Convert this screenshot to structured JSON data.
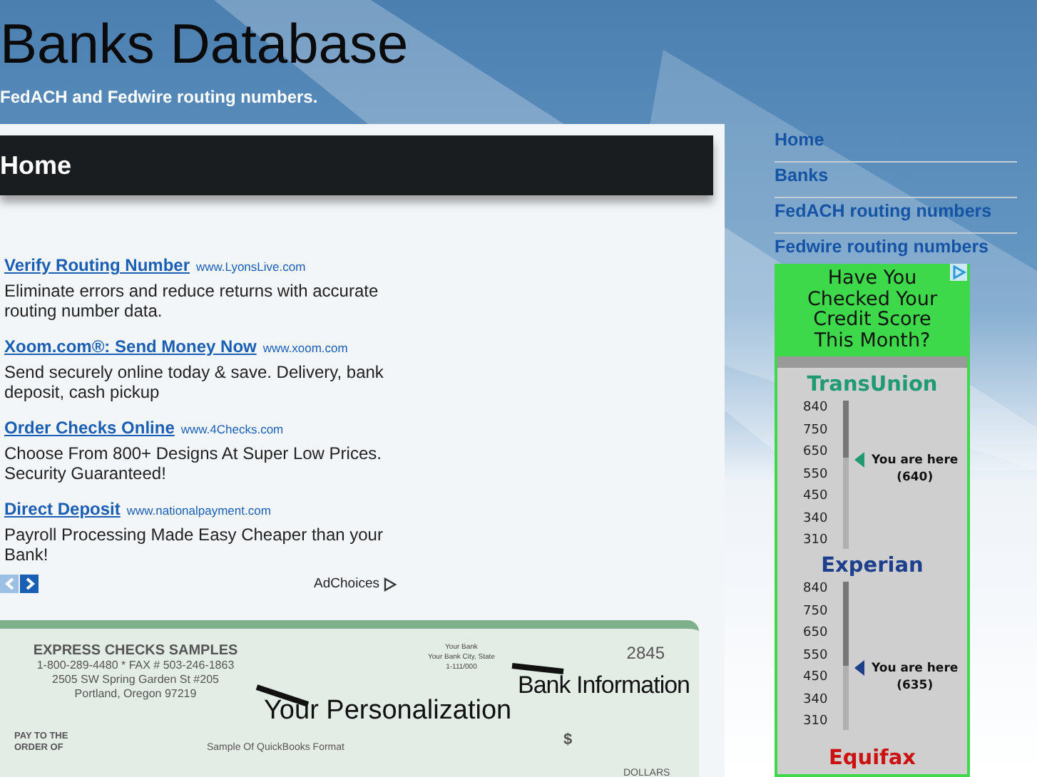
{
  "site": {
    "title": "Banks Database",
    "tagline": "FedACH and Fedwire routing numbers."
  },
  "page_heading": "Home",
  "ads": [
    {
      "title": "Verify Routing Number",
      "url": "www.LyonsLive.com",
      "text": "Eliminate errors and reduce returns with accurate routing number data."
    },
    {
      "title": "Xoom.com®: Send Money Now",
      "url": "www.xoom.com",
      "text": "Send securely online today & save. Delivery, bank deposit, cash pickup"
    },
    {
      "title": "Order Checks Online",
      "url": "www.4Checks.com",
      "text": "Choose From 800+ Designs At Super Low Prices. Security Guaranteed!"
    },
    {
      "title": "Direct Deposit",
      "url": "www.nationalpayment.com",
      "text": "Payroll Processing Made Easy Cheaper than your Bank!"
    }
  ],
  "ad_choices": "AdChoices",
  "check": {
    "company": "EXPRESS CHECKS SAMPLES",
    "address_lines": [
      "1-800-289-4480  *  FAX # 503-246-1863",
      "2505 SW Spring Garden St #205",
      "Portland, Oregon  97219"
    ],
    "bank_lines": [
      "Your Bank",
      "Your Bank City, State",
      "1-111/000"
    ],
    "number": "2845",
    "callout_bank": "Bank Information",
    "callout_personal": "Your Personalization",
    "pay_to": "PAY TO THE ORDER OF",
    "sample": "Sample Of  QuickBooks Format",
    "dollar": "$",
    "dollars": "DOLLARS"
  },
  "nav": [
    {
      "label": "Home"
    },
    {
      "label": "Banks"
    },
    {
      "label": "FedACH routing numbers"
    },
    {
      "label": "Fedwire routing numbers"
    }
  ],
  "credit_ad": {
    "headline": "Have You Checked Your Credit Score This Month?",
    "bureaus": [
      {
        "name": "TransUnion",
        "color": "#1f9a72",
        "ticks": [
          "840",
          "750",
          "650",
          "550",
          "450",
          "340",
          "310"
        ],
        "marker": "You are here",
        "score": "(640)",
        "level": 0.62
      },
      {
        "name": "Experian",
        "color": "#1e3f8c",
        "ticks": [
          "840",
          "750",
          "650",
          "550",
          "450",
          "340",
          "310"
        ],
        "marker": "You are here",
        "score": "(635)",
        "level": 0.43
      }
    ],
    "partial_bureau": {
      "name": "Equifax",
      "color": "#cc1111"
    }
  }
}
